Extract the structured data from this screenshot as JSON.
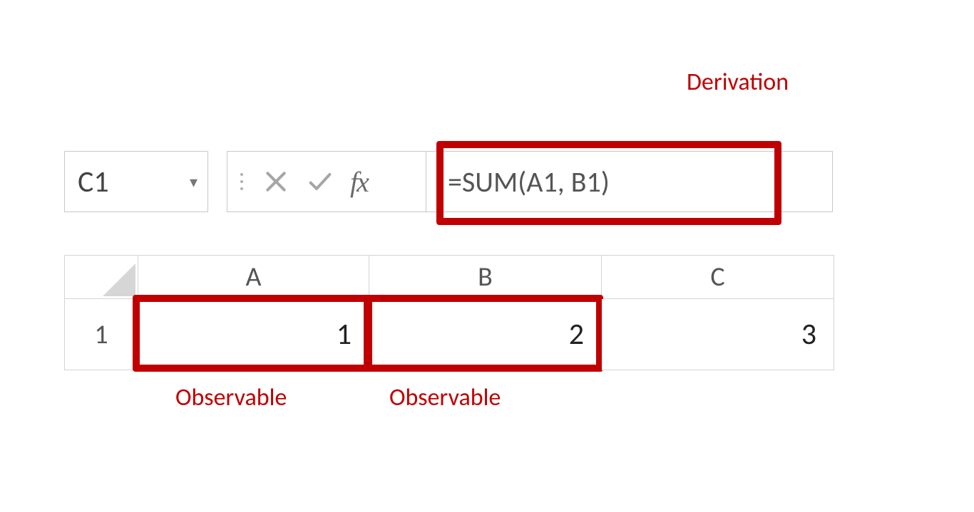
{
  "annotations": {
    "derivation": "Derivation",
    "observable_a": "Observable",
    "observable_b": "Observable"
  },
  "formula_bar": {
    "name_box_value": "C1",
    "fx_label": "fx",
    "formula_text": "=SUM(A1, B1)"
  },
  "grid": {
    "columns": [
      "A",
      "B",
      "C"
    ],
    "rows": [
      "1"
    ],
    "cells": {
      "A1": "1",
      "B1": "2",
      "C1": "3"
    }
  },
  "colors": {
    "highlight": "#c00000",
    "grid_border": "#d4d4d4",
    "header_text": "#555555"
  }
}
